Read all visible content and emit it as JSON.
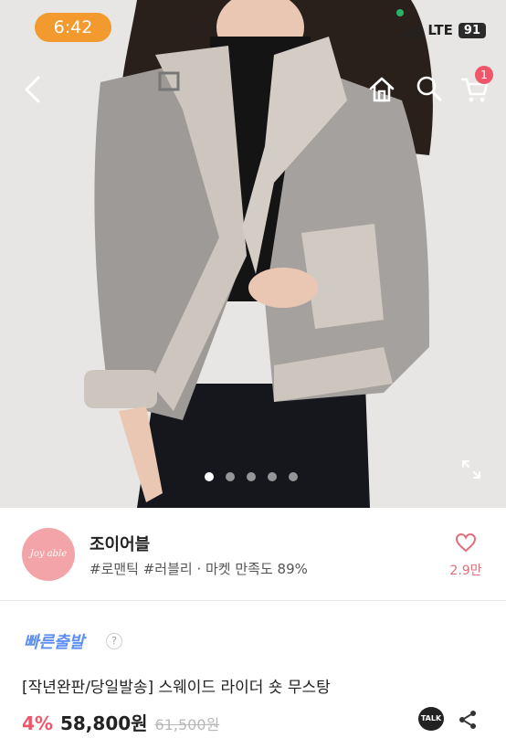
{
  "status_bar": {
    "time": "6:42",
    "network": "LTE",
    "battery": "91"
  },
  "nav": {
    "back_icon": "chevron-left-icon",
    "home_icon": "home-icon",
    "search_icon": "search-icon",
    "cart_icon": "cart-icon",
    "cart_count": "1"
  },
  "gallery": {
    "image_count": 5,
    "active_index": 0,
    "expand_icon": "expand-icon"
  },
  "seller": {
    "avatar_text": "Joy able",
    "name": "조이어블",
    "tags": "#로맨틱 #러블리 · 마켓 만족도 89%",
    "like_count": "2.9만"
  },
  "product": {
    "badge": "빠른출발",
    "help": "?",
    "title": "[작년완판/당일발송] 스웨이드 라이더 숏 무스탕",
    "discount": "4%",
    "price": "58,800원",
    "original_price": "61,500원",
    "talk_label": "TALK"
  },
  "colors": {
    "accent": "#f0566a",
    "badge_blue": "#5e8ff2",
    "time_pill": "#f39a2e",
    "avatar_pink": "#f3a4a9"
  }
}
